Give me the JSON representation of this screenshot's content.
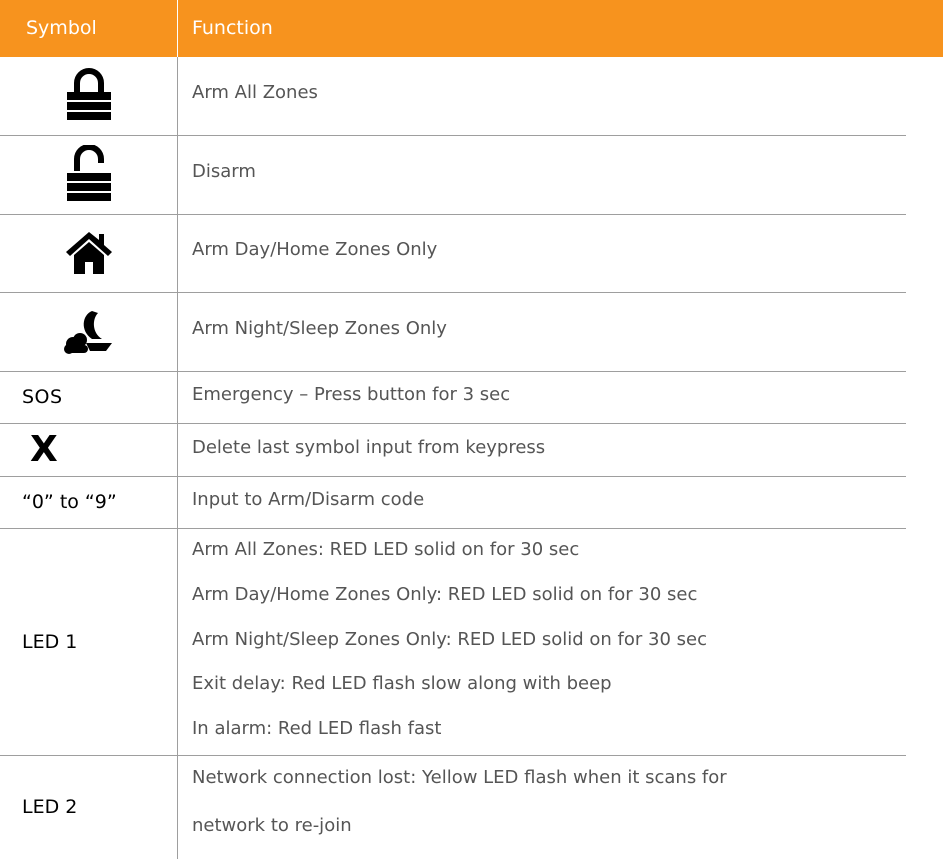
{
  "header": {
    "symbol": "Symbol",
    "function": "Function"
  },
  "rows": [
    {
      "symbol_icon": "locked-padlock-icon",
      "function": "Arm All Zones"
    },
    {
      "symbol_icon": "unlocked-padlock-icon",
      "function": "Disarm"
    },
    {
      "symbol_icon": "house-icon",
      "function": "Arm Day/Home Zones Only"
    },
    {
      "symbol_icon": "night-moon-cloud-icon",
      "function": "Arm Night/Sleep Zones Only"
    },
    {
      "symbol_text": "SOS",
      "function": "Emergency – Press button for 3 sec"
    },
    {
      "symbol_text": "X",
      "function": "Delete last symbol input from keypress"
    },
    {
      "symbol_text": "“0” to “9”",
      "function": "Input to Arm/Disarm code"
    }
  ],
  "led1": {
    "label": "LED 1",
    "lines": [
      "Arm All Zones:  RED LED solid on for 30 sec",
      "Arm Day/Home Zones Only: RED LED solid on for 30 sec",
      "Arm Night/Sleep Zones Only: RED LED solid on for 30 sec",
      "Exit delay: Red LED flash slow along with beep",
      "In alarm: Red LED flash fast"
    ]
  },
  "led2": {
    "label": "LED 2",
    "lines": [
      "Network connection lost: Yellow LED flash when it scans for",
      "network to re-join"
    ]
  },
  "colors": {
    "header_bg": "#f7931e",
    "header_text": "#ffffff",
    "body_text": "#555555",
    "grid": "#9e9e9e"
  }
}
